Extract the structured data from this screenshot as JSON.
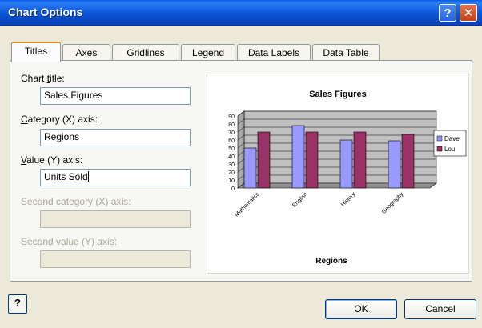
{
  "window": {
    "title": "Chart Options",
    "help_glyph": "?",
    "close_glyph": "✕"
  },
  "tabs": [
    {
      "label": "Titles",
      "active": true
    },
    {
      "label": "Axes",
      "active": false
    },
    {
      "label": "Gridlines",
      "active": false
    },
    {
      "label": "Legend",
      "active": false
    },
    {
      "label": "Data Labels",
      "active": false
    },
    {
      "label": "Data Table",
      "active": false
    }
  ],
  "form": {
    "chart_title": {
      "label_pre": "Chart ",
      "label_key": "t",
      "label_post": "itle:",
      "value": "Sales Figures"
    },
    "category_axis": {
      "label_pre": "",
      "label_key": "C",
      "label_post": "ategory (X) axis:",
      "value": "Regions"
    },
    "value_axis": {
      "label_pre": "",
      "label_key": "V",
      "label_post": "alue (Y) axis:",
      "value": "Units Sold"
    },
    "second_category_axis": {
      "label": "Second category (X) axis:",
      "value": ""
    },
    "second_value_axis": {
      "label": "Second value (Y) axis:",
      "value": ""
    }
  },
  "chart_data": {
    "type": "bar",
    "title": "Sales Figures",
    "xlabel": "Regions",
    "ylabel": "",
    "categories": [
      "Mathematics",
      "English",
      "History",
      "Geography"
    ],
    "series": [
      {
        "name": "Dave",
        "values": [
          50,
          78,
          60,
          59
        ],
        "color": "#9999ff"
      },
      {
        "name": "Lou",
        "values": [
          70,
          70,
          70,
          67
        ],
        "color": "#993366"
      }
    ],
    "ylim": [
      0,
      90
    ],
    "yticks": [
      "0",
      "10",
      "20",
      "30",
      "40",
      "50",
      "60",
      "70",
      "80",
      "90"
    ],
    "plot_background": "#c0c0c0",
    "grid": true,
    "legend": "right"
  },
  "buttons": {
    "help_glyph": "?",
    "ok": "OK",
    "cancel": "Cancel"
  },
  "colors": {
    "titlebar": "#0a55d6",
    "dialog_bg": "#ece9d8",
    "active_tab_accent": "#e68b2c"
  }
}
